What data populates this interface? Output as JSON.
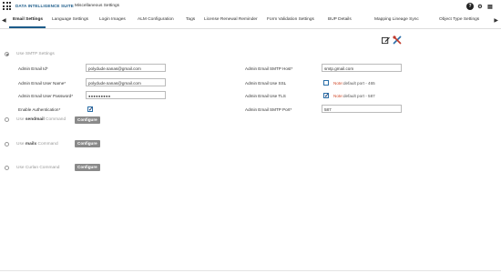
{
  "app": {
    "title": "DATA INTELLIGENCE SUITE",
    "page_title": "Miscellaneous Settings"
  },
  "top_icons": [
    "help-icon",
    "gear-icon",
    "document-icon"
  ],
  "tabs": [
    {
      "label": "Email Settings",
      "active": true
    },
    {
      "label": "Language Settings",
      "active": false
    },
    {
      "label": "Login Images",
      "active": false
    },
    {
      "label": "ALM Configuration",
      "active": false
    },
    {
      "label": "Tags",
      "active": false
    },
    {
      "label": "License Renewal Reminder",
      "active": false
    },
    {
      "label": "Form Validation Settings",
      "active": false
    },
    {
      "label": "BUP Details",
      "active": false
    },
    {
      "label": "Mapping Lineage Sync",
      "active": false
    },
    {
      "label": "Object Type Settings",
      "active": false
    }
  ],
  "tab_arrows": {
    "left": "◀",
    "right": "▶"
  },
  "toolbar": {
    "edit_icon": "edit-icon",
    "tools_icon": "tools-icon"
  },
  "smtp": {
    "option_label": "Use SMTP Settings",
    "selected": true,
    "left_fields": [
      {
        "label": "Admin Email Id*",
        "value": "polydude.sanas@gmail.com"
      },
      {
        "label": "Admin Email User Name*",
        "value": "polydude.sanas@gmail.com"
      },
      {
        "label": "Admin Email User Password*",
        "value": "●●●●●●●●●"
      }
    ],
    "auth": {
      "label": "Enable Authentication*",
      "checked": true
    },
    "host": {
      "label": "Admin Email SMTP Host*",
      "value": "smtp.gmail.com"
    },
    "ssl": {
      "label": "Admin Email Use SSL",
      "checked": false,
      "note_prefix": "Note:",
      "note_text": "default port - 465"
    },
    "tls": {
      "label": "Admin Email Use TLS",
      "checked": true,
      "note_prefix": "Note:",
      "note_text": "default port - 587"
    },
    "port": {
      "label": "Admin Email SMTP Port*",
      "value": "587"
    }
  },
  "sendmail": {
    "prefix": "Use ",
    "name": "sendmail",
    "suffix": " Command",
    "button": "Configure"
  },
  "mailx": {
    "prefix": "Use ",
    "name": "mailx",
    "suffix": " Command",
    "button": "Configure"
  },
  "curlan": {
    "label": "Use Curlan Command",
    "button": "Configure"
  },
  "colors": {
    "accent": "#1c5c8a",
    "note": "#d04a2a",
    "button_bg": "#8a8a8a"
  }
}
